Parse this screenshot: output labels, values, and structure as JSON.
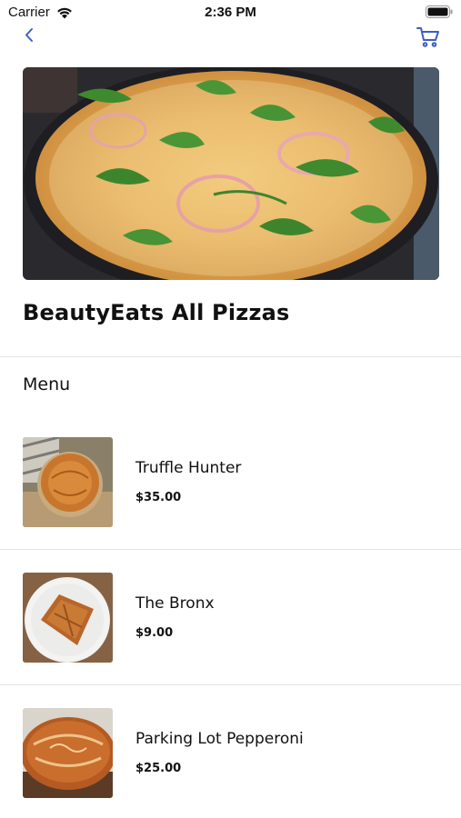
{
  "status_bar": {
    "carrier": "Carrier",
    "time": "2:36 PM"
  },
  "nav": {
    "back_icon": "chevron-left-icon",
    "cart_icon": "shopping-cart-icon",
    "accent_color": "#3b5fc0"
  },
  "store": {
    "hero_image": "pizza-dish-photo",
    "title": "BeautyEats All Pizzas"
  },
  "menu": {
    "heading": "Menu",
    "items": [
      {
        "name": "Truffle Hunter",
        "price": "$35.00",
        "image": "pie-on-cloth-photo"
      },
      {
        "name": "The Bronx",
        "price": "$9.00",
        "image": "pastry-on-plate-photo"
      },
      {
        "name": "Parking Lot Pepperoni",
        "price": "$25.00",
        "image": "decorated-pie-photo"
      }
    ]
  }
}
